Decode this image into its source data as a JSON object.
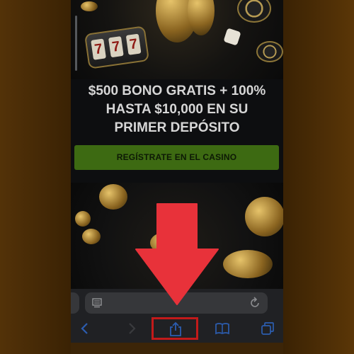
{
  "promo": {
    "line1": "$500 BONO GRATIS + 100%",
    "line2": "HASTA $10,000 EN SU",
    "line3": "PRIMER DEPÓSITO"
  },
  "cta": {
    "label": "REGÍSTRATE EN EL CASINO"
  },
  "slot": {
    "reels": [
      "7",
      "7",
      "7"
    ]
  },
  "browser": {
    "icons": {
      "page_icon": "page-settings-icon",
      "reload": "reload-icon",
      "back": "back-icon",
      "forward": "forward-icon",
      "share": "share-icon",
      "bookmarks": "bookmarks-icon",
      "tabs": "tabs-icon"
    }
  },
  "colors": {
    "cta_green": "#3d6a12",
    "arrow_red": "#e8323a",
    "highlight_red": "#c21a1a",
    "toolbar_blue": "#2c5db0",
    "frame_brown": "#3a2204"
  }
}
